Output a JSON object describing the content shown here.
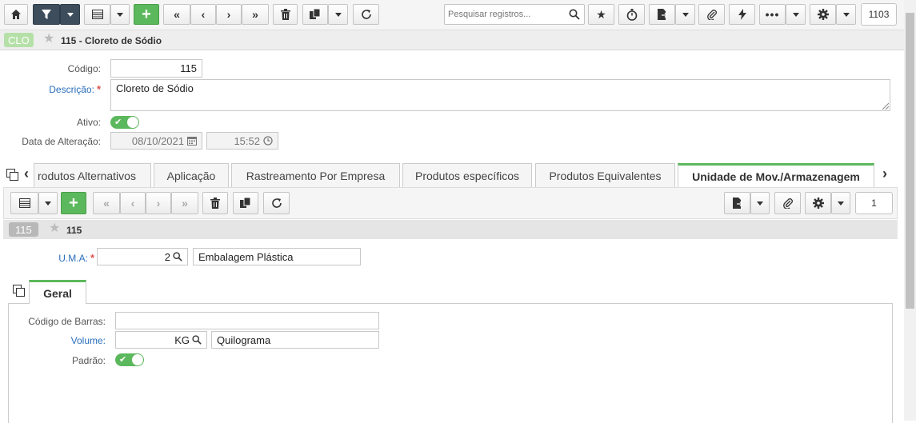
{
  "toolbar": {
    "search_placeholder": "Pesquisar registros...",
    "record_counter": "1103"
  },
  "record": {
    "badge": "CLO",
    "badge_color": "#b5e0a8",
    "title": "115 - Cloreto de Sódio"
  },
  "form": {
    "codigo_label": "Código:",
    "codigo_value": "115",
    "descricao_label": "Descrição:",
    "descricao_value": "Cloreto de Sódio",
    "ativo_label": "Ativo:",
    "ativo_value": true,
    "data_label": "Data de Alteração:",
    "data_value": "08/10/2021",
    "hora_value": "15:52"
  },
  "tabs": [
    {
      "label": "rodutos Alternativos"
    },
    {
      "label": "Aplicação"
    },
    {
      "label": "Rastreamento Por Empresa"
    },
    {
      "label": "Produtos específicos"
    },
    {
      "label": "Produtos Equivalentes"
    },
    {
      "label": "Unidade de Mov./Armazenagem",
      "active": true
    }
  ],
  "subrecord": {
    "counter": "1",
    "badge": "115",
    "title": "115",
    "uma_label": "U.M.A:",
    "uma_code": "2",
    "uma_desc": "Embalagem Plástica"
  },
  "inner_tab": {
    "label": "Geral"
  },
  "geral": {
    "barcode_label": "Código de Barras:",
    "barcode_value": "",
    "volume_label": "Volume:",
    "volume_code": "KG",
    "volume_desc": "Quilograma",
    "padrao_label": "Padrão:",
    "padrao_value": true
  },
  "colors": {
    "accent_green": "#5cb85c",
    "dark_button": "#3d4d5c",
    "link_blue": "#2a6ebb"
  }
}
